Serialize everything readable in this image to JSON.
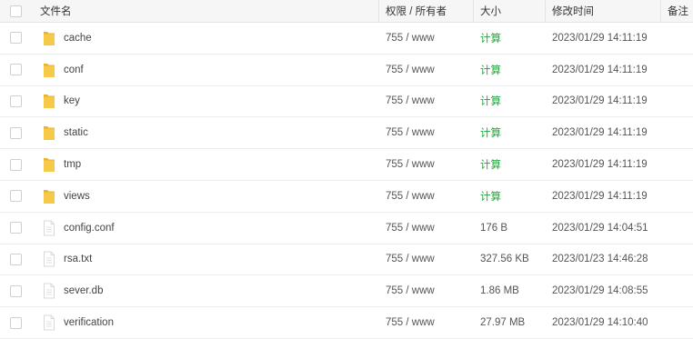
{
  "table": {
    "headers": {
      "name": "文件名",
      "permission": "权限 / 所有者",
      "size": "大小",
      "mtime": "修改时间",
      "note": "备注"
    },
    "rows": [
      {
        "type": "folder",
        "name": "cache",
        "permission": "755 / www",
        "size": "计算",
        "size_is_action": true,
        "mtime": "2023/01/29 14:11:19"
      },
      {
        "type": "folder",
        "name": "conf",
        "permission": "755 / www",
        "size": "计算",
        "size_is_action": true,
        "mtime": "2023/01/29 14:11:19"
      },
      {
        "type": "folder",
        "name": "key",
        "permission": "755 / www",
        "size": "计算",
        "size_is_action": true,
        "mtime": "2023/01/29 14:11:19"
      },
      {
        "type": "folder",
        "name": "static",
        "permission": "755 / www",
        "size": "计算",
        "size_is_action": true,
        "mtime": "2023/01/29 14:11:19"
      },
      {
        "type": "folder",
        "name": "tmp",
        "permission": "755 / www",
        "size": "计算",
        "size_is_action": true,
        "mtime": "2023/01/29 14:11:19"
      },
      {
        "type": "folder",
        "name": "views",
        "permission": "755 / www",
        "size": "计算",
        "size_is_action": true,
        "mtime": "2023/01/29 14:11:19"
      },
      {
        "type": "file",
        "name": "config.conf",
        "permission": "755 / www",
        "size": "176 B",
        "size_is_action": false,
        "mtime": "2023/01/29 14:04:51"
      },
      {
        "type": "file",
        "name": "rsa.txt",
        "permission": "755 / www",
        "size": "327.56 KB",
        "size_is_action": false,
        "mtime": "2023/01/23 14:46:28"
      },
      {
        "type": "file",
        "name": "sever.db",
        "permission": "755 / www",
        "size": "1.86 MB",
        "size_is_action": false,
        "mtime": "2023/01/29 14:08:55"
      },
      {
        "type": "file",
        "name": "verification",
        "permission": "755 / www",
        "size": "27.97 MB",
        "size_is_action": false,
        "mtime": "2023/01/29 14:10:40"
      }
    ]
  },
  "colors": {
    "folder": "#f7c948",
    "folder_dark": "#e9b331",
    "file": "#d9d9d9",
    "calc_link": "#20a53a"
  }
}
